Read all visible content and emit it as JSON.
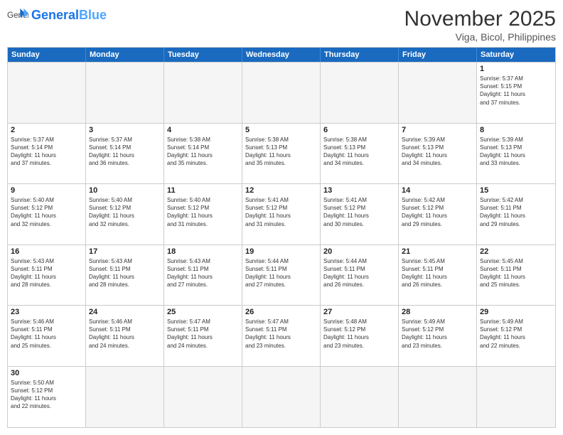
{
  "logo": {
    "general": "General",
    "blue": "Blue"
  },
  "header": {
    "title": "November 2025",
    "location": "Viga, Bicol, Philippines"
  },
  "weekdays": [
    "Sunday",
    "Monday",
    "Tuesday",
    "Wednesday",
    "Thursday",
    "Friday",
    "Saturday"
  ],
  "days": [
    {
      "num": "",
      "empty": true,
      "info": ""
    },
    {
      "num": "",
      "empty": true,
      "info": ""
    },
    {
      "num": "",
      "empty": true,
      "info": ""
    },
    {
      "num": "",
      "empty": true,
      "info": ""
    },
    {
      "num": "",
      "empty": true,
      "info": ""
    },
    {
      "num": "",
      "empty": true,
      "info": ""
    },
    {
      "num": "1",
      "empty": false,
      "info": "Sunrise: 5:37 AM\nSunset: 5:15 PM\nDaylight: 11 hours\nand 37 minutes."
    },
    {
      "num": "2",
      "empty": false,
      "info": "Sunrise: 5:37 AM\nSunset: 5:14 PM\nDaylight: 11 hours\nand 37 minutes."
    },
    {
      "num": "3",
      "empty": false,
      "info": "Sunrise: 5:37 AM\nSunset: 5:14 PM\nDaylight: 11 hours\nand 36 minutes."
    },
    {
      "num": "4",
      "empty": false,
      "info": "Sunrise: 5:38 AM\nSunset: 5:14 PM\nDaylight: 11 hours\nand 35 minutes."
    },
    {
      "num": "5",
      "empty": false,
      "info": "Sunrise: 5:38 AM\nSunset: 5:13 PM\nDaylight: 11 hours\nand 35 minutes."
    },
    {
      "num": "6",
      "empty": false,
      "info": "Sunrise: 5:38 AM\nSunset: 5:13 PM\nDaylight: 11 hours\nand 34 minutes."
    },
    {
      "num": "7",
      "empty": false,
      "info": "Sunrise: 5:39 AM\nSunset: 5:13 PM\nDaylight: 11 hours\nand 34 minutes."
    },
    {
      "num": "8",
      "empty": false,
      "info": "Sunrise: 5:39 AM\nSunset: 5:13 PM\nDaylight: 11 hours\nand 33 minutes."
    },
    {
      "num": "9",
      "empty": false,
      "info": "Sunrise: 5:40 AM\nSunset: 5:12 PM\nDaylight: 11 hours\nand 32 minutes."
    },
    {
      "num": "10",
      "empty": false,
      "info": "Sunrise: 5:40 AM\nSunset: 5:12 PM\nDaylight: 11 hours\nand 32 minutes."
    },
    {
      "num": "11",
      "empty": false,
      "info": "Sunrise: 5:40 AM\nSunset: 5:12 PM\nDaylight: 11 hours\nand 31 minutes."
    },
    {
      "num": "12",
      "empty": false,
      "info": "Sunrise: 5:41 AM\nSunset: 5:12 PM\nDaylight: 11 hours\nand 31 minutes."
    },
    {
      "num": "13",
      "empty": false,
      "info": "Sunrise: 5:41 AM\nSunset: 5:12 PM\nDaylight: 11 hours\nand 30 minutes."
    },
    {
      "num": "14",
      "empty": false,
      "info": "Sunrise: 5:42 AM\nSunset: 5:12 PM\nDaylight: 11 hours\nand 29 minutes."
    },
    {
      "num": "15",
      "empty": false,
      "info": "Sunrise: 5:42 AM\nSunset: 5:11 PM\nDaylight: 11 hours\nand 29 minutes."
    },
    {
      "num": "16",
      "empty": false,
      "info": "Sunrise: 5:43 AM\nSunset: 5:11 PM\nDaylight: 11 hours\nand 28 minutes."
    },
    {
      "num": "17",
      "empty": false,
      "info": "Sunrise: 5:43 AM\nSunset: 5:11 PM\nDaylight: 11 hours\nand 28 minutes."
    },
    {
      "num": "18",
      "empty": false,
      "info": "Sunrise: 5:43 AM\nSunset: 5:11 PM\nDaylight: 11 hours\nand 27 minutes."
    },
    {
      "num": "19",
      "empty": false,
      "info": "Sunrise: 5:44 AM\nSunset: 5:11 PM\nDaylight: 11 hours\nand 27 minutes."
    },
    {
      "num": "20",
      "empty": false,
      "info": "Sunrise: 5:44 AM\nSunset: 5:11 PM\nDaylight: 11 hours\nand 26 minutes."
    },
    {
      "num": "21",
      "empty": false,
      "info": "Sunrise: 5:45 AM\nSunset: 5:11 PM\nDaylight: 11 hours\nand 26 minutes."
    },
    {
      "num": "22",
      "empty": false,
      "info": "Sunrise: 5:45 AM\nSunset: 5:11 PM\nDaylight: 11 hours\nand 25 minutes."
    },
    {
      "num": "23",
      "empty": false,
      "info": "Sunrise: 5:46 AM\nSunset: 5:11 PM\nDaylight: 11 hours\nand 25 minutes."
    },
    {
      "num": "24",
      "empty": false,
      "info": "Sunrise: 5:46 AM\nSunset: 5:11 PM\nDaylight: 11 hours\nand 24 minutes."
    },
    {
      "num": "25",
      "empty": false,
      "info": "Sunrise: 5:47 AM\nSunset: 5:11 PM\nDaylight: 11 hours\nand 24 minutes."
    },
    {
      "num": "26",
      "empty": false,
      "info": "Sunrise: 5:47 AM\nSunset: 5:11 PM\nDaylight: 11 hours\nand 23 minutes."
    },
    {
      "num": "27",
      "empty": false,
      "info": "Sunrise: 5:48 AM\nSunset: 5:12 PM\nDaylight: 11 hours\nand 23 minutes."
    },
    {
      "num": "28",
      "empty": false,
      "info": "Sunrise: 5:49 AM\nSunset: 5:12 PM\nDaylight: 11 hours\nand 23 minutes."
    },
    {
      "num": "29",
      "empty": false,
      "info": "Sunrise: 5:49 AM\nSunset: 5:12 PM\nDaylight: 11 hours\nand 22 minutes."
    },
    {
      "num": "30",
      "empty": false,
      "info": "Sunrise: 5:50 AM\nSunset: 5:12 PM\nDaylight: 11 hours\nand 22 minutes."
    },
    {
      "num": "",
      "empty": true,
      "info": ""
    },
    {
      "num": "",
      "empty": true,
      "info": ""
    },
    {
      "num": "",
      "empty": true,
      "info": ""
    },
    {
      "num": "",
      "empty": true,
      "info": ""
    },
    {
      "num": "",
      "empty": true,
      "info": ""
    },
    {
      "num": "",
      "empty": true,
      "info": ""
    }
  ]
}
